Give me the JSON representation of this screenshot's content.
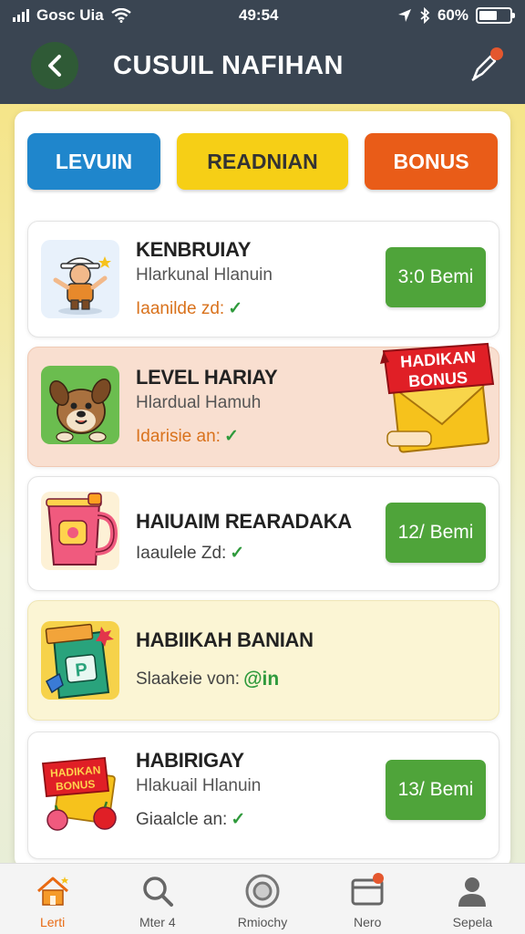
{
  "status_bar": {
    "carrier": "Gosc Uia",
    "time": "49:54",
    "battery": "60%"
  },
  "header": {
    "title": "CUSUIL NAFIHAN",
    "back_icon": "chevron-left-icon",
    "edit_icon": "pen-icon"
  },
  "tabs": [
    {
      "label": "LEVUIN",
      "color": "#1f86cc"
    },
    {
      "label": "READNIAN",
      "color": "#f6cf16"
    },
    {
      "label": "BONUS",
      "color": "#e95c18"
    }
  ],
  "items": [
    {
      "title": "KENBRUIAY",
      "subtitle": "Hlarkunal Hlanuin",
      "meta": "Iaanilde zd:",
      "button": "3:0 Bemi"
    },
    {
      "title": "LEVEL HARIAY",
      "subtitle": "Hlardual Hamuh",
      "meta": "Idarisie an:",
      "ribbon": [
        "HADIKAN",
        "BONUS"
      ]
    },
    {
      "title": "HAIUAIM REARADAKA",
      "meta": "Iaaulele Zd:",
      "button": "12/ Bemi"
    },
    {
      "title": "HABIIKAH BANIAN",
      "meta": "Slaakeie von:",
      "meta_extra": "@in"
    },
    {
      "title": "HABIRIGAY",
      "subtitle": "Hlakuail Hlanuin",
      "meta": "Giaalcle an:",
      "button": "13/ Bemi",
      "thumb_text": [
        "HADIKAN",
        "BONUS"
      ]
    }
  ],
  "nav": [
    {
      "label": "Lerti",
      "icon": "home-icon"
    },
    {
      "label": "Mter 4",
      "icon": "search-icon"
    },
    {
      "label": "Rmiochy",
      "icon": "camera-icon"
    },
    {
      "label": "Nero",
      "icon": "inbox-icon"
    },
    {
      "label": "Sepela",
      "icon": "profile-icon"
    }
  ]
}
